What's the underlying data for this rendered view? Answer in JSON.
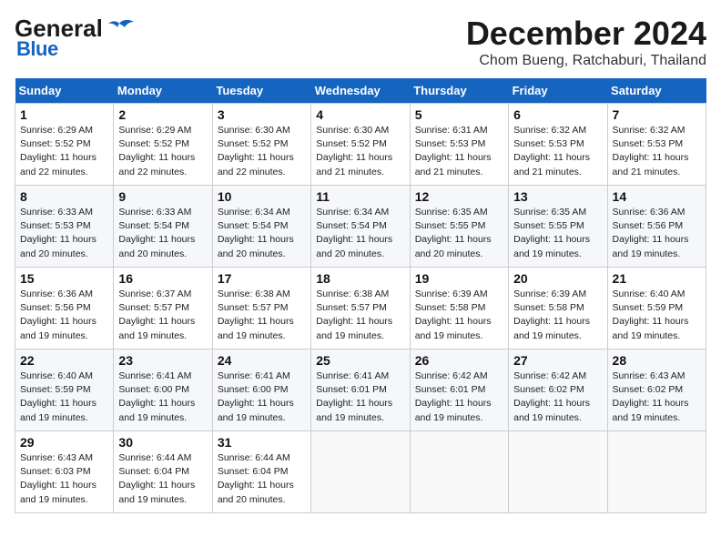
{
  "header": {
    "logo_general": "General",
    "logo_blue": "Blue",
    "month_title": "December 2024",
    "location": "Chom Bueng, Ratchaburi, Thailand"
  },
  "days_of_week": [
    "Sunday",
    "Monday",
    "Tuesday",
    "Wednesday",
    "Thursday",
    "Friday",
    "Saturday"
  ],
  "weeks": [
    [
      {
        "day": "1",
        "info": "Sunrise: 6:29 AM\nSunset: 5:52 PM\nDaylight: 11 hours\nand 22 minutes."
      },
      {
        "day": "2",
        "info": "Sunrise: 6:29 AM\nSunset: 5:52 PM\nDaylight: 11 hours\nand 22 minutes."
      },
      {
        "day": "3",
        "info": "Sunrise: 6:30 AM\nSunset: 5:52 PM\nDaylight: 11 hours\nand 22 minutes."
      },
      {
        "day": "4",
        "info": "Sunrise: 6:30 AM\nSunset: 5:52 PM\nDaylight: 11 hours\nand 21 minutes."
      },
      {
        "day": "5",
        "info": "Sunrise: 6:31 AM\nSunset: 5:53 PM\nDaylight: 11 hours\nand 21 minutes."
      },
      {
        "day": "6",
        "info": "Sunrise: 6:32 AM\nSunset: 5:53 PM\nDaylight: 11 hours\nand 21 minutes."
      },
      {
        "day": "7",
        "info": "Sunrise: 6:32 AM\nSunset: 5:53 PM\nDaylight: 11 hours\nand 21 minutes."
      }
    ],
    [
      {
        "day": "8",
        "info": "Sunrise: 6:33 AM\nSunset: 5:53 PM\nDaylight: 11 hours\nand 20 minutes."
      },
      {
        "day": "9",
        "info": "Sunrise: 6:33 AM\nSunset: 5:54 PM\nDaylight: 11 hours\nand 20 minutes."
      },
      {
        "day": "10",
        "info": "Sunrise: 6:34 AM\nSunset: 5:54 PM\nDaylight: 11 hours\nand 20 minutes."
      },
      {
        "day": "11",
        "info": "Sunrise: 6:34 AM\nSunset: 5:54 PM\nDaylight: 11 hours\nand 20 minutes."
      },
      {
        "day": "12",
        "info": "Sunrise: 6:35 AM\nSunset: 5:55 PM\nDaylight: 11 hours\nand 20 minutes."
      },
      {
        "day": "13",
        "info": "Sunrise: 6:35 AM\nSunset: 5:55 PM\nDaylight: 11 hours\nand 19 minutes."
      },
      {
        "day": "14",
        "info": "Sunrise: 6:36 AM\nSunset: 5:56 PM\nDaylight: 11 hours\nand 19 minutes."
      }
    ],
    [
      {
        "day": "15",
        "info": "Sunrise: 6:36 AM\nSunset: 5:56 PM\nDaylight: 11 hours\nand 19 minutes."
      },
      {
        "day": "16",
        "info": "Sunrise: 6:37 AM\nSunset: 5:57 PM\nDaylight: 11 hours\nand 19 minutes."
      },
      {
        "day": "17",
        "info": "Sunrise: 6:38 AM\nSunset: 5:57 PM\nDaylight: 11 hours\nand 19 minutes."
      },
      {
        "day": "18",
        "info": "Sunrise: 6:38 AM\nSunset: 5:57 PM\nDaylight: 11 hours\nand 19 minutes."
      },
      {
        "day": "19",
        "info": "Sunrise: 6:39 AM\nSunset: 5:58 PM\nDaylight: 11 hours\nand 19 minutes."
      },
      {
        "day": "20",
        "info": "Sunrise: 6:39 AM\nSunset: 5:58 PM\nDaylight: 11 hours\nand 19 minutes."
      },
      {
        "day": "21",
        "info": "Sunrise: 6:40 AM\nSunset: 5:59 PM\nDaylight: 11 hours\nand 19 minutes."
      }
    ],
    [
      {
        "day": "22",
        "info": "Sunrise: 6:40 AM\nSunset: 5:59 PM\nDaylight: 11 hours\nand 19 minutes."
      },
      {
        "day": "23",
        "info": "Sunrise: 6:41 AM\nSunset: 6:00 PM\nDaylight: 11 hours\nand 19 minutes."
      },
      {
        "day": "24",
        "info": "Sunrise: 6:41 AM\nSunset: 6:00 PM\nDaylight: 11 hours\nand 19 minutes."
      },
      {
        "day": "25",
        "info": "Sunrise: 6:41 AM\nSunset: 6:01 PM\nDaylight: 11 hours\nand 19 minutes."
      },
      {
        "day": "26",
        "info": "Sunrise: 6:42 AM\nSunset: 6:01 PM\nDaylight: 11 hours\nand 19 minutes."
      },
      {
        "day": "27",
        "info": "Sunrise: 6:42 AM\nSunset: 6:02 PM\nDaylight: 11 hours\nand 19 minutes."
      },
      {
        "day": "28",
        "info": "Sunrise: 6:43 AM\nSunset: 6:02 PM\nDaylight: 11 hours\nand 19 minutes."
      }
    ],
    [
      {
        "day": "29",
        "info": "Sunrise: 6:43 AM\nSunset: 6:03 PM\nDaylight: 11 hours\nand 19 minutes."
      },
      {
        "day": "30",
        "info": "Sunrise: 6:44 AM\nSunset: 6:04 PM\nDaylight: 11 hours\nand 19 minutes."
      },
      {
        "day": "31",
        "info": "Sunrise: 6:44 AM\nSunset: 6:04 PM\nDaylight: 11 hours\nand 20 minutes."
      },
      {
        "day": "",
        "info": ""
      },
      {
        "day": "",
        "info": ""
      },
      {
        "day": "",
        "info": ""
      },
      {
        "day": "",
        "info": ""
      }
    ]
  ]
}
